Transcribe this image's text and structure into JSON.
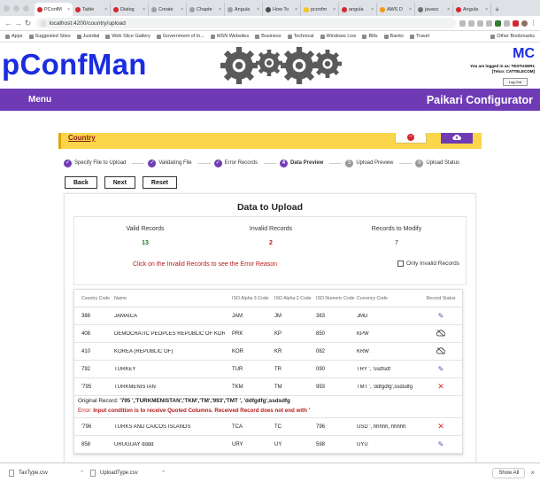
{
  "browser": {
    "tabs": [
      {
        "label": "PConfM",
        "color": "#d6262d",
        "active": true
      },
      {
        "label": "Table",
        "color": "#d6262d"
      },
      {
        "label": "Dialog",
        "color": "#d6262d"
      },
      {
        "label": "Create",
        "color": "#9aa0a6"
      },
      {
        "label": "Chapte",
        "color": "#9aa0a6"
      },
      {
        "label": "Angula",
        "color": "#9aa0a6"
      },
      {
        "label": "How To",
        "color": "#4a4a4a"
      },
      {
        "label": "pconfm",
        "color": "#f5c518"
      },
      {
        "label": "angula",
        "color": "#d6262d"
      },
      {
        "label": "AWS D",
        "color": "#f39c12"
      },
      {
        "label": "javasc",
        "color": "#6f6f6f"
      },
      {
        "label": "Angula",
        "color": "#d6262d"
      }
    ],
    "url": "localhost:4200/country/upload",
    "bookmarks": [
      "Apps",
      "Suggested Sites",
      "Justdial",
      "Web Slice Gallery",
      "Government of In...",
      "MSN Websites",
      "Business",
      "Technical",
      "Windows Live",
      "Bills",
      "Banks",
      "Travel"
    ],
    "other_bookmarks": "Other Bookmarks"
  },
  "header": {
    "logo": "pConfMan",
    "mc": "MC",
    "login_line1": "You are logged in as: TESTUSER1",
    "login_line2": "[Telco: CATTELECOM]",
    "logout": "Log Out"
  },
  "menubar": {
    "menu": "Menu",
    "brand": "Paikari Configurator"
  },
  "country_bar": {
    "link": "Country"
  },
  "steps": [
    {
      "num": "✓",
      "label": "Specify File to Upload",
      "state": "done"
    },
    {
      "num": "✓",
      "label": "Validating File",
      "state": "done"
    },
    {
      "num": "✓",
      "label": "Error Records",
      "state": "done"
    },
    {
      "num": "4",
      "label": "Data Preview",
      "state": "current"
    },
    {
      "num": "5",
      "label": "Upload Preview",
      "state": "pending"
    },
    {
      "num": "6",
      "label": "Upload Status",
      "state": "pending"
    }
  ],
  "actions": {
    "back": "Back",
    "next": "Next",
    "reset": "Reset"
  },
  "panel": {
    "title": "Data to Upload",
    "valid_label": "Valid Records",
    "valid_count": "13",
    "invalid_label": "Invalid Records",
    "invalid_count": "2",
    "modify_label": "Records to Modify",
    "modify_count": "7",
    "hint": "Click on the Invalid Records to see the Error Reason",
    "only_invalid": "Only Invalid Records"
  },
  "table": {
    "headers": [
      "Country Code",
      "Name",
      "ISO Alpha 3 Code",
      "ISO Alpha 2 Code",
      "ISO Numeric Code",
      "Currency Code",
      "Record Status"
    ],
    "rows": [
      {
        "code": "388",
        "name": "JAMAICA",
        "a3": "JAM",
        "a2": "JM",
        "num": "383",
        "cur": "JMD",
        "status": "edit"
      },
      {
        "code": "408",
        "name": "DEMOCRATIC PEOPLES REPUBLIC OF KOREA",
        "a3": "PRK",
        "a2": "KP",
        "num": "850",
        "cur": "KPW",
        "status": "cloud"
      },
      {
        "code": "410",
        "name": "KOREA (REPUBLIC OF)",
        "a3": "KOR",
        "a2": "KR",
        "num": "082",
        "cur": "KRW",
        "status": "cloud"
      },
      {
        "code": "792",
        "name": "TURKEY",
        "a3": "TUR",
        "a2": "TR",
        "num": "090",
        "cur": "TRY ', 'ssdfsdf",
        "status": "edit"
      },
      {
        "code": "'795",
        "name": "TURKMENISTAN",
        "a3": "TKM",
        "a2": "TM",
        "num": "993",
        "cur": "TMT ', 'ddfgdfg',ssdsdfg",
        "status": "delete"
      },
      {
        "code": "'796",
        "name": "TURKS AND CAICOS ISLANDS",
        "a3": "TCA",
        "a2": "TC",
        "num": "796",
        "cur": "USD ', hhhhh, hhhhh",
        "status": "delete"
      },
      {
        "code": "858",
        "name": "URUGUAY dddd",
        "a3": "URY",
        "a2": "UY",
        "num": "598",
        "cur": "UYU",
        "status": "edit"
      }
    ],
    "error": {
      "orig_label": "Original Record:",
      "orig_value": "'795 ','TURKMENISTAN','TKM','TM','993','TMT ', 'ddfgdfg',ssdsdfg",
      "err_label": "Error:",
      "err_value": "Input condition is to receive Quoted Columns. Received Record does not end with '"
    }
  },
  "downloads": {
    "files": [
      "TaxType.csv",
      "UploadType.csv"
    ],
    "show_all": "Show All"
  },
  "colors": {
    "purple": "#6f3bb5",
    "yellow": "#fbd64a",
    "red": "#d6262d",
    "logo_blue": "#1a2de0"
  }
}
